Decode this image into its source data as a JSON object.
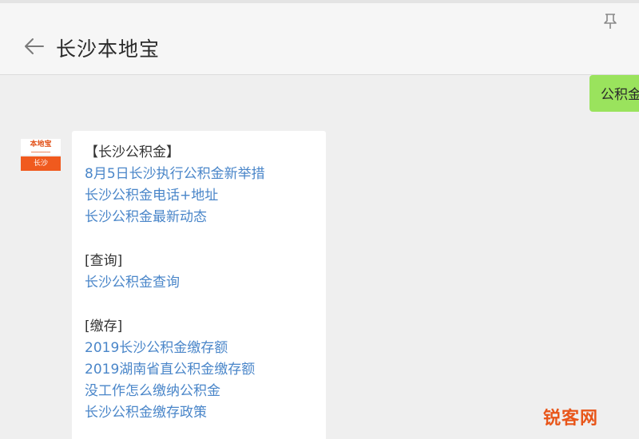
{
  "header": {
    "title": "长沙本地宝"
  },
  "user_message": {
    "text": "公积金"
  },
  "avatar": {
    "brand": "本地宝",
    "city": "长沙"
  },
  "message": {
    "sections": [
      {
        "heading": "【长沙公积金】",
        "links": [
          "8月5日长沙执行公积金新举措",
          "长沙公积金电话+地址",
          "长沙公积金最新动态"
        ]
      },
      {
        "heading": "[查询]",
        "links": [
          "长沙公积金查询"
        ]
      },
      {
        "heading": "[缴存]",
        "links": [
          "2019长沙公积金缴存额",
          "2019湖南省直公积金缴存额",
          "没工作怎么缴纳公积金",
          "长沙公积金缴存政策"
        ]
      }
    ]
  },
  "watermark": "锐客网",
  "colors": {
    "link": "#4a86c9",
    "user_bubble": "#9ae35d",
    "brand_orange": "#f05a1e"
  }
}
